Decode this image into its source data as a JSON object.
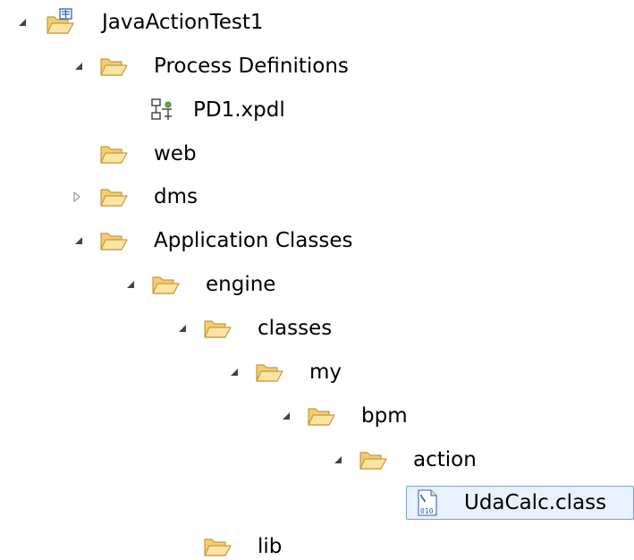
{
  "tree": {
    "project": {
      "label": "JavaActionTest1",
      "icon": "project-folder-icon",
      "expanded": true
    },
    "process_definitions": {
      "label": "Process Definitions",
      "icon": "folder-icon",
      "expanded": true
    },
    "pd1": {
      "label": "PD1.xpdl",
      "icon": "xpdl-process-file-icon"
    },
    "web": {
      "label": "web",
      "icon": "folder-icon"
    },
    "dms": {
      "label": "dms",
      "icon": "folder-icon",
      "expanded": false
    },
    "application_classes": {
      "label": "Application Classes",
      "icon": "folder-icon",
      "expanded": true
    },
    "engine": {
      "label": "engine",
      "icon": "folder-icon",
      "expanded": true
    },
    "classes": {
      "label": "classes",
      "icon": "folder-icon",
      "expanded": true
    },
    "my": {
      "label": "my",
      "icon": "folder-icon",
      "expanded": true
    },
    "bpm": {
      "label": "bpm",
      "icon": "folder-icon",
      "expanded": true
    },
    "action": {
      "label": "action",
      "icon": "folder-icon",
      "expanded": true
    },
    "udacalc": {
      "label": "UdaCalc.class",
      "icon": "java-class-file-icon",
      "selected": true
    },
    "lib": {
      "label": "lib",
      "icon": "folder-icon"
    }
  },
  "colors": {
    "folder_fill": "#f7d88a",
    "folder_stroke": "#c59a3a",
    "selection_border": "#7da2ce",
    "selection_fill": "#e8f1fc",
    "twisty_expanded": "#444444",
    "twisty_collapsed": "#9a9a9a"
  }
}
